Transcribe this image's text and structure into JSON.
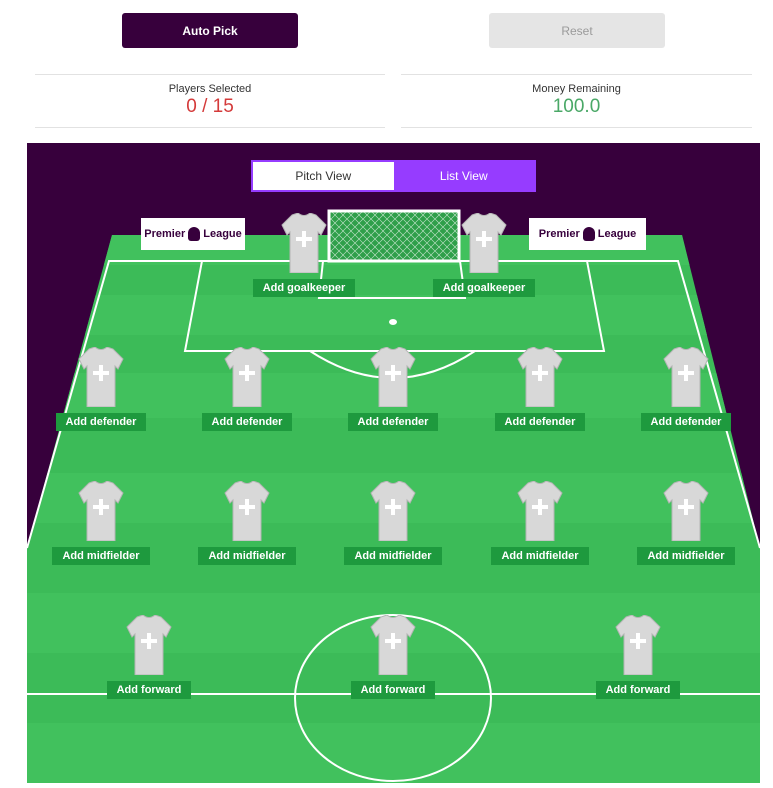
{
  "toolbar": {
    "auto_pick_label": "Auto Pick",
    "reset_label": "Reset"
  },
  "stats": {
    "players_selected_label": "Players Selected",
    "players_selected_value": "0 / 15",
    "money_remaining_label": "Money Remaining",
    "money_remaining_value": "100.0"
  },
  "view_toggle": {
    "pitch_label": "Pitch View",
    "list_label": "List View",
    "active": "List View"
  },
  "sponsor": {
    "left_text": "Premier League",
    "right_text": "Premier League",
    "left_a": "Premier",
    "left_b": "League",
    "right_a": "Premier",
    "right_b": "League"
  },
  "slots": {
    "gk1": "Add goalkeeper",
    "gk2": "Add goalkeeper",
    "def1": "Add defender",
    "def2": "Add defender",
    "def3": "Add defender",
    "def4": "Add defender",
    "def5": "Add defender",
    "mid1": "Add midfielder",
    "mid2": "Add midfielder",
    "mid3": "Add midfielder",
    "mid4": "Add midfielder",
    "mid5": "Add midfielder",
    "fwd1": "Add forward",
    "fwd2": "Add forward",
    "fwd3": "Add forward"
  },
  "colors": {
    "brand_purple": "#37003c",
    "accent_purple": "#963cff",
    "pitch_green": "#38b653",
    "alert_red": "#d43a3a",
    "money_green": "#4aa867"
  }
}
